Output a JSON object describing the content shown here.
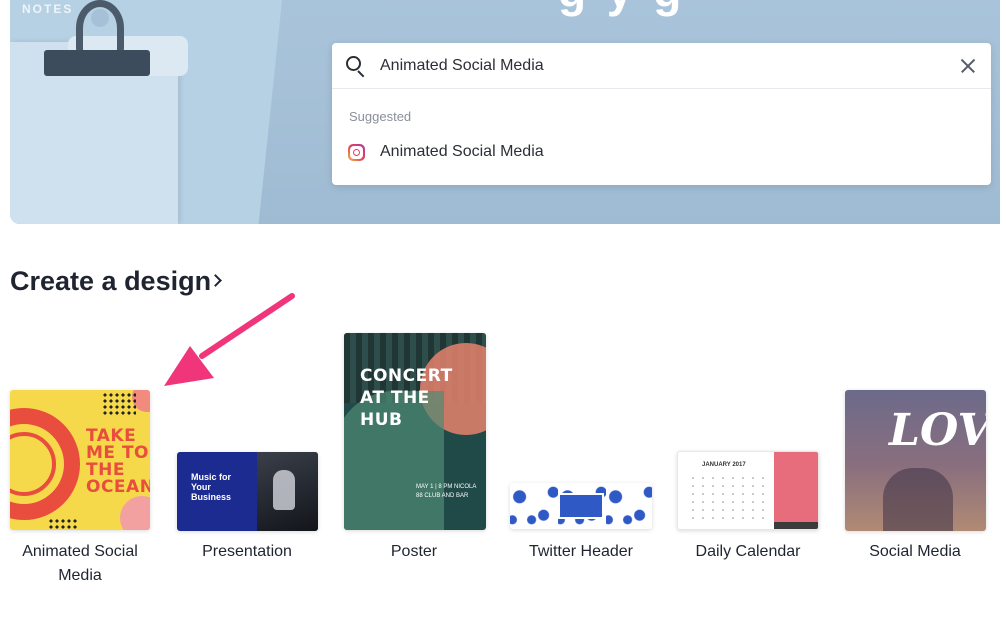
{
  "hero": {
    "notes_label": "NOTES",
    "heading_fragment": "g y g"
  },
  "search": {
    "value": "Animated Social Media",
    "placeholder": "",
    "suggested_label": "Suggested",
    "suggestions": [
      {
        "label": "Animated Social Media",
        "icon": "instagram-icon"
      }
    ]
  },
  "section": {
    "title": "Create a design",
    "chevron": "›"
  },
  "designs": [
    {
      "label": "Animated Social Media",
      "thumb_text": "TAKE ME TO THE OCEAN"
    },
    {
      "label": "Presentation",
      "thumb_text": "Music for Your Business"
    },
    {
      "label": "Poster",
      "thumb_text": "CONCERT AT THE HUB",
      "thumb_subtext": "MAY 1 | 8 PM NICOLA 88 CLUB AND BAR"
    },
    {
      "label": "Twitter Header",
      "thumb_text": ""
    },
    {
      "label": "Daily Calendar",
      "thumb_text": "JANUARY 2017"
    },
    {
      "label": "Social Media",
      "thumb_text": "LOVE"
    }
  ],
  "colors": {
    "hero_bg": "#a9c4da",
    "annotation_arrow": "#f0357a",
    "text_primary": "#1f2430"
  }
}
